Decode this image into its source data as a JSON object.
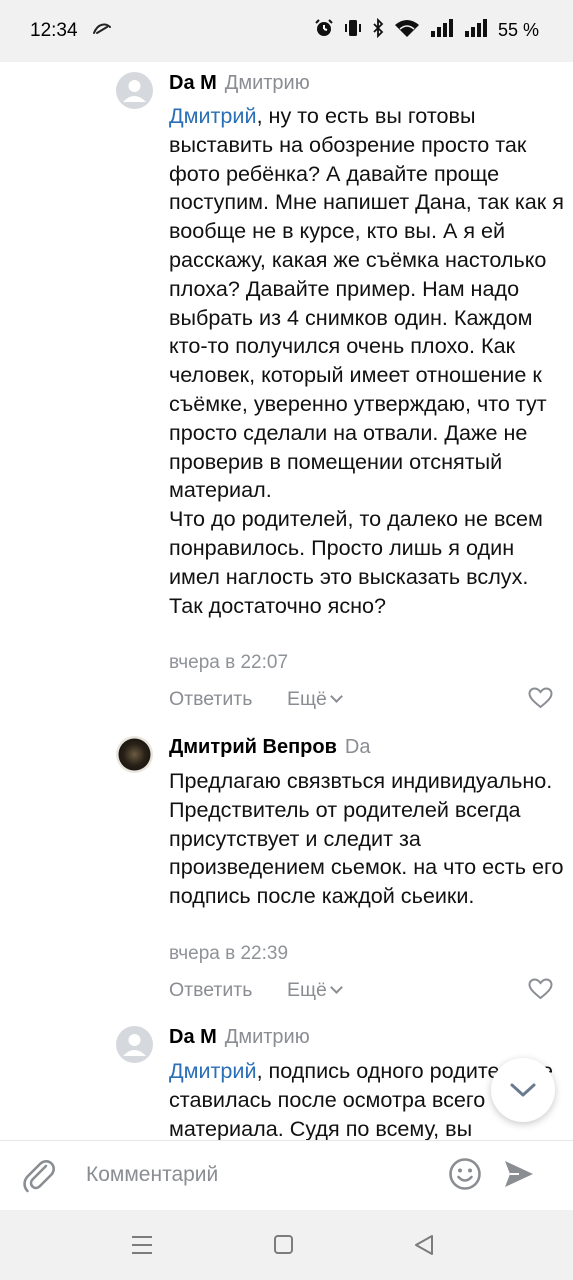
{
  "status_bar": {
    "time": "12:34",
    "battery": "55 %"
  },
  "comments": [
    {
      "author": "Da M",
      "reply_to": "Дмитрию",
      "mention": "Дмитрий",
      "text": ", ну то есть вы готовы выставить на обозрение просто так фото ребёнка? А давайте проще поступим. Мне напишет Дана, так как я вообще не в курсе, кто вы. А я ей расскажу, какая же съёмка настолько плоха? Давайте пример. Нам надо выбрать из 4 снимков один. Каждом кто-то получился очень плохо. Как человек, который имеет отношение к съёмке, уверенно утверждаю, что тут просто сделали на отвали. Даже не проверив в помещении отснятый материал.\nЧто до родителей, то далеко не всем понравилось. Просто лишь я один имел наглость это высказать вслух. Так достаточно ясно?",
      "time": "вчера в 22:07",
      "reply_label": "Ответить",
      "more_label": "Ещё"
    },
    {
      "author": "Дмитрий Вепров",
      "reply_to": "Da",
      "text": "Предлагаю связвться индивидуально. Предствитель от родителей всегда присутствует и следит за произведением сьемок. на что есть его подпись после каждой сьеики.",
      "time": "вчера в 22:39",
      "reply_label": "Ответить",
      "more_label": "Ещё"
    },
    {
      "author": "Da M",
      "reply_to": "Дмитрию",
      "mention": "Дмитрий",
      "text": ", подпись одного родителя не ставилась после осмотра всего материала. Судя по всему, вы"
    }
  ],
  "composer": {
    "placeholder": "Комментарий"
  }
}
